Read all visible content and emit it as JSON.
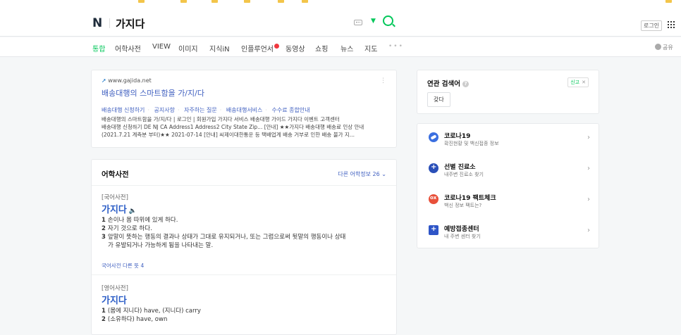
{
  "search": {
    "logo": "N",
    "query": "가지다"
  },
  "header": {
    "login_label": "로그인"
  },
  "tabs": [
    {
      "label": "통합",
      "active": true
    },
    {
      "label": "어학사전"
    },
    {
      "label": "VIEW"
    },
    {
      "label": "이미지"
    },
    {
      "label": "지식iN"
    },
    {
      "label": "인플루언서"
    },
    {
      "label": "동영상"
    },
    {
      "label": "쇼핑"
    },
    {
      "label": "뉴스"
    },
    {
      "label": "지도"
    }
  ],
  "share_label": "공유",
  "web_result": {
    "url": "www.gajida.net",
    "title": "배송대행의 스마트함을 가/지/다",
    "sitelinks": [
      "배송대행 신청하기",
      "공지사항",
      "자주하는 질문",
      "배송대행서비스",
      "수수료 종합안내"
    ],
    "desc_lines": [
      "배송대행의 스마트함을 가/지/다 | 로그인 | 회원가입 가지다 서비스 배송대행 가이드 가지다 이벤트 고객센터",
      "배송대행 신청하기 DE NJ CA Address1 Address2 City State Zip... [안내] ★★가지다 배송대행 배송료 인상 안내",
      "(2021.7.21 계측분 부터)★★ 2021-07-14 [안내] 씨제이대한통운 등 택배업계 배송 거부로 인한 배송 불가 지..."
    ]
  },
  "dictionary": {
    "heading": "어학사전",
    "more_label": "다른 어학정보 26",
    "korean": {
      "category": "[국어사전]",
      "word": "가지다",
      "definitions": [
        {
          "num": "1",
          "text": "손이나 몸 따위에 있게 하다."
        },
        {
          "num": "2",
          "text": "자기 것으로 하다."
        },
        {
          "num": "3",
          "text": "앞말이 뜻하는 행동의 결과나 상태가 그대로 유지되거나, 또는 그럼으로써 뒷말의 행동이나 상태"
        },
        {
          "num": "",
          "text": "가 유발되거나 가능하게 됨을 나타내는 말."
        }
      ],
      "more": "국어사전 다른 뜻 4"
    },
    "english": {
      "category": "[영어사전]",
      "word": "가지다",
      "definitions": [
        {
          "num": "1",
          "text": "(몸에 지니다) have, (지니다) carry"
        },
        {
          "num": "2",
          "text": "(소유하다) have, own"
        }
      ]
    }
  },
  "related": {
    "heading": "연관 검색어",
    "report_label": "신고",
    "chips": [
      "갖다"
    ]
  },
  "side_links": [
    {
      "title": "코로나19",
      "sub": "확진현황 및 백신접종 정보",
      "icon": "corona-icon"
    },
    {
      "title": "선별 진료소",
      "sub": "내주변 진료소 찾기",
      "icon": "clinic-icon"
    },
    {
      "title": "코로나19 팩트체크",
      "sub": "백신 정보 팩트는?",
      "icon": "factcheck-icon"
    },
    {
      "title": "예방접종센터",
      "sub": "내 주변 센터 찾기",
      "icon": "vaccination-center-icon"
    }
  ],
  "colors": {
    "brand_green": "#03c75a",
    "link_blue": "#4060c0",
    "word_blue": "#2a5cc6"
  }
}
